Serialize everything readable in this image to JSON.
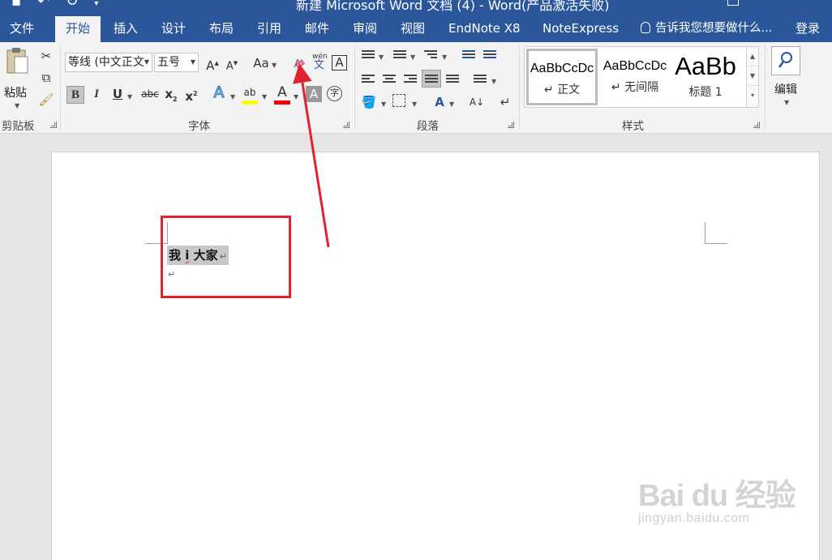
{
  "title_bar": {
    "doc_title": "新建 Microsoft Word 文档 (4) - Word(产品激活失败)"
  },
  "tabs": [
    "文件",
    "开始",
    "插入",
    "设计",
    "布局",
    "引用",
    "邮件",
    "审阅",
    "视图",
    "EndNote X8",
    "NoteExpress"
  ],
  "tell_me": "告诉我您想要做什么...",
  "login": "登录",
  "clipboard": {
    "paste_label": "粘贴",
    "group_label": "剪贴板"
  },
  "font": {
    "font_name": "等线 (中文正文",
    "font_size": "五号",
    "grow_glyph": "A",
    "shrink_glyph": "A",
    "case_glyph": "Aa",
    "phonetic_glyph": "wén",
    "phonetic_char": "文",
    "border_glyph": "A",
    "bold": "B",
    "italic": "I",
    "underline": "U",
    "strike": "abc",
    "subscript": "x",
    "sub2": "2",
    "superscript": "x",
    "sup2": "2",
    "effects_glyph": "A",
    "highlight_glyph": "ab",
    "font_color_glyph": "A",
    "shading_glyph": "A",
    "enclose_glyph": "字",
    "group_label": "字体"
  },
  "paragraph": {
    "group_label": "段落"
  },
  "styles": {
    "items": [
      {
        "preview": "AaBbCcDc",
        "name": "↵ 正文"
      },
      {
        "preview": "AaBbCcDc",
        "name": "↵ 无间隔"
      },
      {
        "preview": "AaBb",
        "name": "标题 1"
      }
    ],
    "group_label": "样式"
  },
  "editing": {
    "label": "编辑"
  },
  "document": {
    "line1_a": "我 ",
    "line1_b": "i",
    "line1_c": " 大家",
    "para_mark": "↵"
  },
  "watermark": {
    "main": "Bai du 经验",
    "sub": "jingyan.baidu.com"
  },
  "colors": {
    "accent": "#2b579a",
    "annotation": "#e0242f",
    "highlight": "#ffff00",
    "font_color": "#ff0000"
  }
}
